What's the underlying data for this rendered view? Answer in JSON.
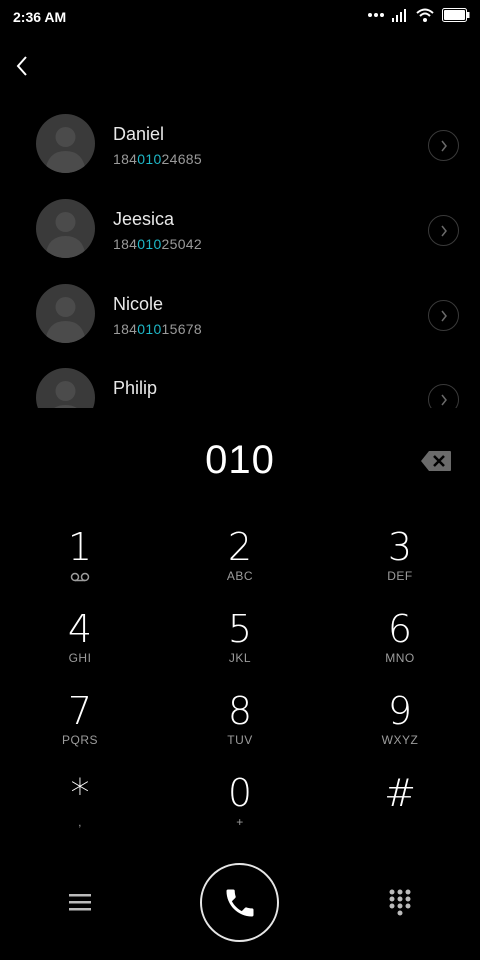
{
  "status": {
    "time": "2:36 AM"
  },
  "contacts": [
    {
      "name": "Daniel",
      "num_prefix": "184",
      "num_match": "010",
      "num_suffix": "24685"
    },
    {
      "name": "Jeesica",
      "num_prefix": "184",
      "num_match": "010",
      "num_suffix": "25042"
    },
    {
      "name": "Nicole",
      "num_prefix": "184",
      "num_match": "010",
      "num_suffix": "15678"
    },
    {
      "name": "Philip",
      "num_prefix": "",
      "num_match": "",
      "num_suffix": ""
    }
  ],
  "dialer": {
    "input": "010"
  },
  "keys": [
    {
      "num": "1",
      "sub": "",
      "icon": "voicemail-icon"
    },
    {
      "num": "2",
      "sub": "ABC"
    },
    {
      "num": "3",
      "sub": "DEF"
    },
    {
      "num": "4",
      "sub": "GHI"
    },
    {
      "num": "5",
      "sub": "JKL"
    },
    {
      "num": "6",
      "sub": "MNO"
    },
    {
      "num": "7",
      "sub": "PQRS"
    },
    {
      "num": "8",
      "sub": "TUV"
    },
    {
      "num": "9",
      "sub": "WXYZ"
    },
    {
      "num": "*",
      "sub": ","
    },
    {
      "num": "0",
      "sub": "+"
    },
    {
      "num": "#",
      "sub": ""
    }
  ],
  "colors": {
    "background": "#000000",
    "match_highlight": "#1fb8c8"
  }
}
